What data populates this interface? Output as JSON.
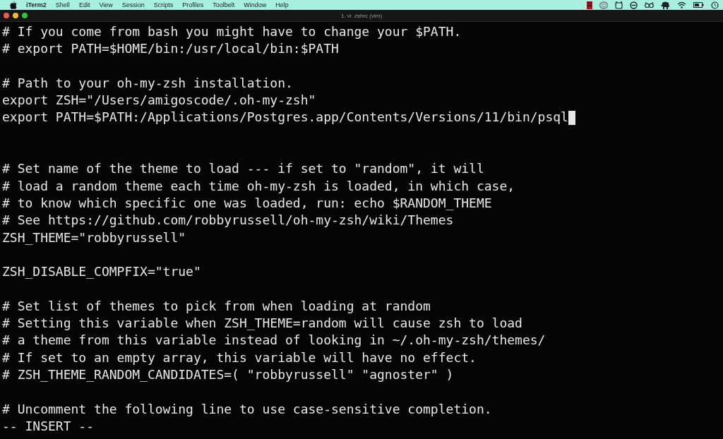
{
  "menu_bar": {
    "app_name": "iTerm2",
    "items": [
      "Shell",
      "Edit",
      "View",
      "Session",
      "Scripts",
      "Profiles",
      "Toolbelt",
      "Window",
      "Help"
    ]
  },
  "window": {
    "title": "1. vi .zshrc (vim)"
  },
  "editor": {
    "lines": [
      {
        "kind": "text",
        "text": "# If you come from bash you might have to change your $PATH.",
        "cursor": false
      },
      {
        "kind": "text",
        "text": "# export PATH=$HOME/bin:/usr/local/bin:$PATH",
        "cursor": false
      },
      {
        "kind": "blank"
      },
      {
        "kind": "text",
        "text": "# Path to your oh-my-zsh installation.",
        "cursor": false
      },
      {
        "kind": "text",
        "text": "export ZSH=\"/Users/amigoscode/.oh-my-zsh\"",
        "cursor": false
      },
      {
        "kind": "text",
        "text": "export PATH=$PATH:/Applications/Postgres.app/Contents/Versions/11/bin/psql",
        "cursor": true
      },
      {
        "kind": "blank"
      },
      {
        "kind": "blank"
      },
      {
        "kind": "text",
        "text": "# Set name of the theme to load --- if set to \"random\", it will",
        "cursor": false
      },
      {
        "kind": "text",
        "text": "# load a random theme each time oh-my-zsh is loaded, in which case,",
        "cursor": false
      },
      {
        "kind": "text",
        "text": "# to know which specific one was loaded, run: echo $RANDOM_THEME",
        "cursor": false
      },
      {
        "kind": "text",
        "text": "# See https://github.com/robbyrussell/oh-my-zsh/wiki/Themes",
        "cursor": false
      },
      {
        "kind": "text",
        "text": "ZSH_THEME=\"robbyrussell\"",
        "cursor": false
      },
      {
        "kind": "blank"
      },
      {
        "kind": "text",
        "text": "ZSH_DISABLE_COMPFIX=\"true\"",
        "cursor": false
      },
      {
        "kind": "blank"
      },
      {
        "kind": "text",
        "text": "# Set list of themes to pick from when loading at random",
        "cursor": false
      },
      {
        "kind": "text",
        "text": "# Setting this variable when ZSH_THEME=random will cause zsh to load",
        "cursor": false
      },
      {
        "kind": "text",
        "text": "# a theme from this variable instead of looking in ~/.oh-my-zsh/themes/",
        "cursor": false
      },
      {
        "kind": "text",
        "text": "# If set to an empty array, this variable will have no effect.",
        "cursor": false
      },
      {
        "kind": "text",
        "text": "# ZSH_THEME_RANDOM_CANDIDATES=( \"robbyrussell\" \"agnoster\" )",
        "cursor": false
      },
      {
        "kind": "blank"
      },
      {
        "kind": "text",
        "text": "# Uncomment the following line to use case-sensitive completion.",
        "cursor": false
      }
    ],
    "mode": "-- INSERT --"
  }
}
